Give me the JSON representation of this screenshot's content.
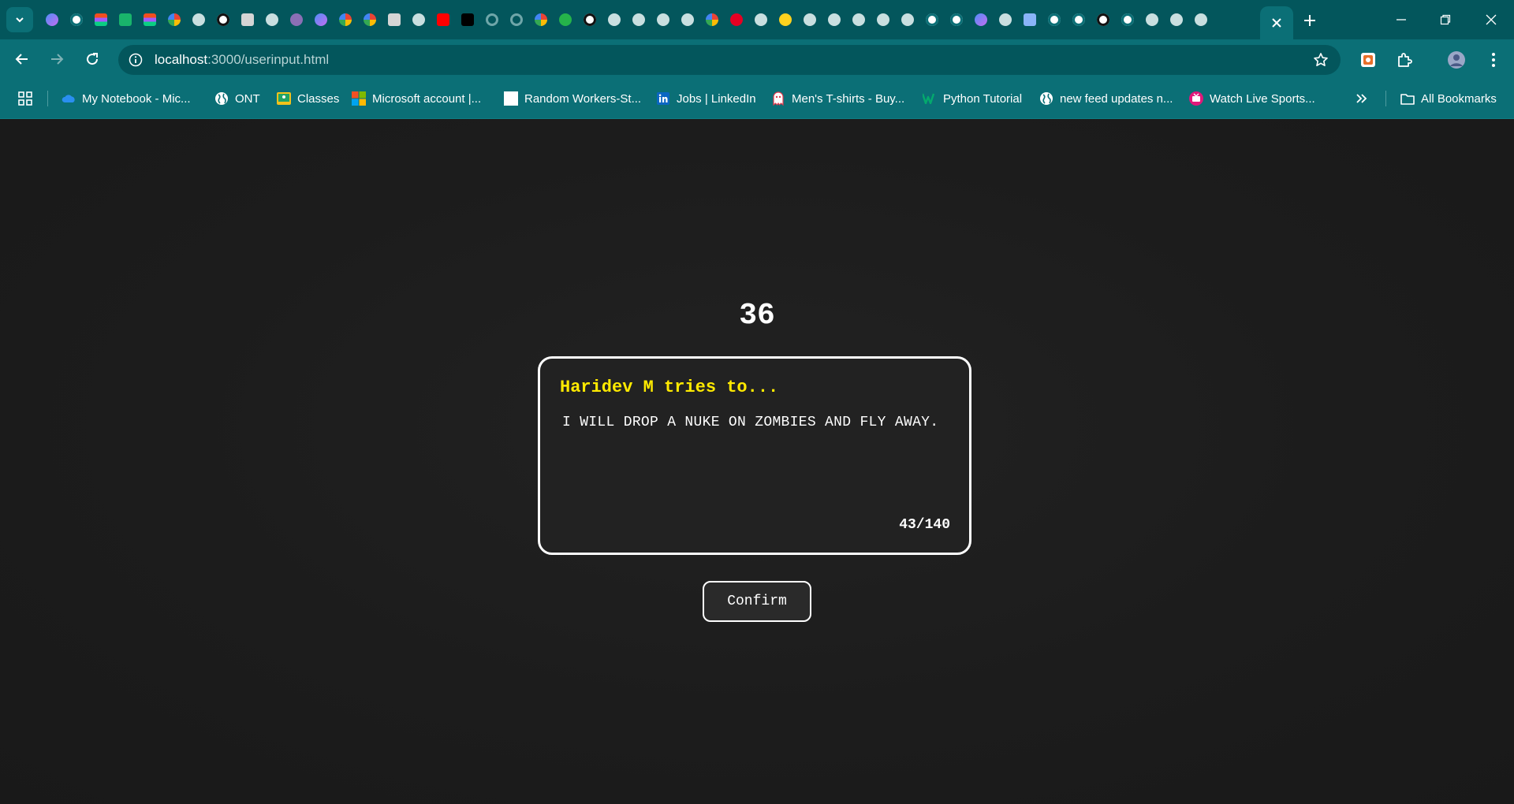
{
  "browser": {
    "url_host": "localhost",
    "url_path": ":3000/userinput.html",
    "tab_favicons": [
      "gemini-icon",
      "chatgpt-icon",
      "figma-icon",
      "webflow-icon",
      "figma-icon",
      "google-icon",
      "globe-icon",
      "github-icon",
      "document-icon",
      "globe-icon",
      "avatar-icon",
      "gemini-icon",
      "google-icon",
      "google-icon",
      "document-icon",
      "globe-icon",
      "youtube-icon",
      "tiktok-icon",
      "loading-icon",
      "loading-icon",
      "google-icon",
      "counter-icon",
      "github-icon",
      "globe-icon",
      "globe-icon",
      "globe-icon",
      "globe-icon",
      "google-icon",
      "pinterest-icon",
      "globe-icon",
      "huggingface-icon",
      "globe-icon",
      "globe-icon",
      "globe-icon",
      "globe-icon",
      "globe-icon",
      "chatgpt-icon",
      "chatgpt-icon",
      "gemini-icon",
      "globe-icon",
      "window-icon",
      "chatgpt-icon",
      "chatgpt-icon",
      "github-icon",
      "chatgpt-icon",
      "globe-icon",
      "globe-icon",
      "globe-icon"
    ],
    "bookmarks": [
      {
        "label": "My Notebook - Mic...",
        "icon": "onedrive-icon"
      },
      {
        "label": "ONT",
        "icon": "globe-icon"
      },
      {
        "label": "Classes",
        "icon": "classroom-icon"
      },
      {
        "label": "Microsoft account |...",
        "icon": "microsoft-icon"
      },
      {
        "label": "Random Workers-St...",
        "icon": "blank-page-icon"
      },
      {
        "label": "Jobs | LinkedIn",
        "icon": "linkedin-icon"
      },
      {
        "label": "Men's T-shirts - Buy...",
        "icon": "ghost-icon"
      },
      {
        "label": "Python Tutorial",
        "icon": "w3schools-icon"
      },
      {
        "label": "new feed updates n...",
        "icon": "globe-icon"
      },
      {
        "label": "Watch Live Sports...",
        "icon": "tv-icon"
      }
    ],
    "all_bookmarks_label": "All Bookmarks"
  },
  "game": {
    "timer": "36",
    "prompt_title": "Haridev M tries to...",
    "input_text": "I WILL DROP A NUKE ON ZOMBIES AND FLY AWAY.",
    "char_count": "43/140",
    "confirm_label": "Confirm"
  },
  "colors": {
    "chrome_tabstrip": "#03565c",
    "chrome_toolbar": "#0b6f76",
    "page_background": "#1c1c1c",
    "title_yellow": "#ffea00",
    "card_border": "#ffffff"
  }
}
